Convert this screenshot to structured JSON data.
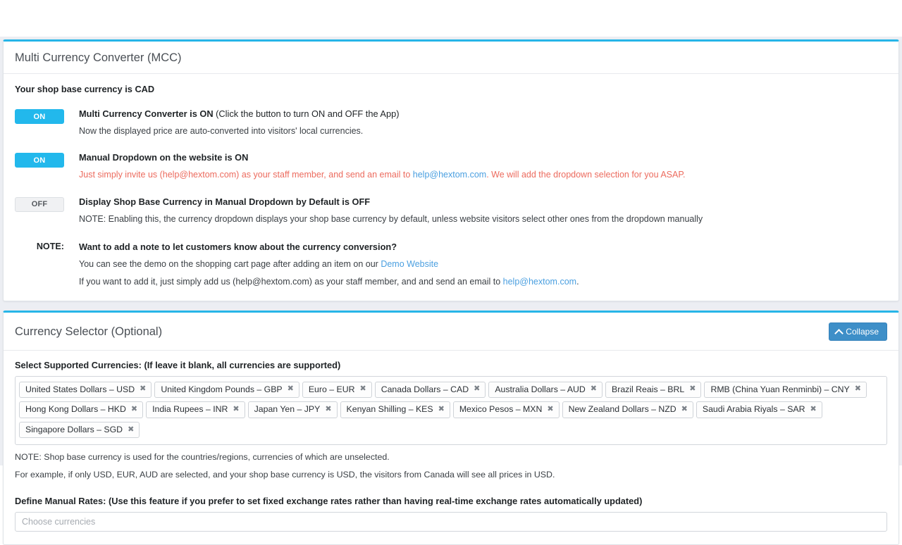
{
  "mcc_card": {
    "title": "Multi Currency Converter (MCC)",
    "base_currency_text": "Your shop base currency is CAD",
    "settings": [
      {
        "toggle_label": "ON",
        "toggle_state": "on",
        "title_bold": "Multi Currency Converter is ON",
        "title_normal": " (Click the button to turn ON and OFF the App)",
        "sub": "Now the displayed price are auto-converted into visitors' local currencies."
      },
      {
        "toggle_label": "ON",
        "toggle_state": "on",
        "title_bold": "Manual Dropdown on the website is ON",
        "title_normal": "",
        "sub_pre": "Just simply invite us (help@hextom.com) as your staff member, and send an email to ",
        "sub_link": "help@hextom.com",
        "sub_post": ". We will add the dropdown selection for you ASAP."
      },
      {
        "toggle_label": "OFF",
        "toggle_state": "off",
        "title_bold": "Display Shop Base Currency in Manual Dropdown by Default is OFF",
        "title_normal": "",
        "sub": "NOTE: Enabling this, the currency dropdown displays your shop base currency by default, unless website visitors select other ones from the dropdown manually"
      }
    ],
    "note": {
      "label": "NOTE:",
      "title": "Want to add a note to let customers know about the currency conversion?",
      "line1_pre": "You can see the demo on the shopping cart page after adding an item on our ",
      "line1_link": "Demo Website",
      "line2_pre": "If you want to add it, just simply add us (help@hextom.com) as your staff member, and and send an email to ",
      "line2_link": "help@hextom.com",
      "line2_post": "."
    }
  },
  "selector_card": {
    "title": "Currency Selector (Optional)",
    "collapse_label": "Collapse",
    "supported_label": "Select Supported Currencies: (If leave it blank, all currencies are supported)",
    "currencies": [
      "United States Dollars – USD",
      "United Kingdom Pounds – GBP",
      "Euro – EUR",
      "Canada Dollars – CAD",
      "Australia Dollars – AUD",
      "Brazil Reais – BRL",
      "RMB (China Yuan Renminbi) – CNY",
      "Hong Kong Dollars – HKD",
      "India Rupees – INR",
      "Japan Yen – JPY",
      "Kenyan Shilling – KES",
      "Mexico Pesos – MXN",
      "New Zealand Dollars – NZD",
      "Saudi Arabia Riyals – SAR",
      "Singapore Dollars – SGD"
    ],
    "remove_glyph": "✖",
    "note_line1": "NOTE: Shop base currency is used for the countries/regions, currencies of which are unselected.",
    "note_line2": "For example, if only USD, EUR, AUD are selected, and your shop base currency is USD, the visitors from Canada will see all prices in USD.",
    "manual_rates_label": "Define Manual Rates: (Use this feature if you prefer to set fixed exchange rates rather than having real-time exchange rates automatically updated)",
    "manual_rates_placeholder": "Choose currencies",
    "manual_rates_value": ""
  }
}
